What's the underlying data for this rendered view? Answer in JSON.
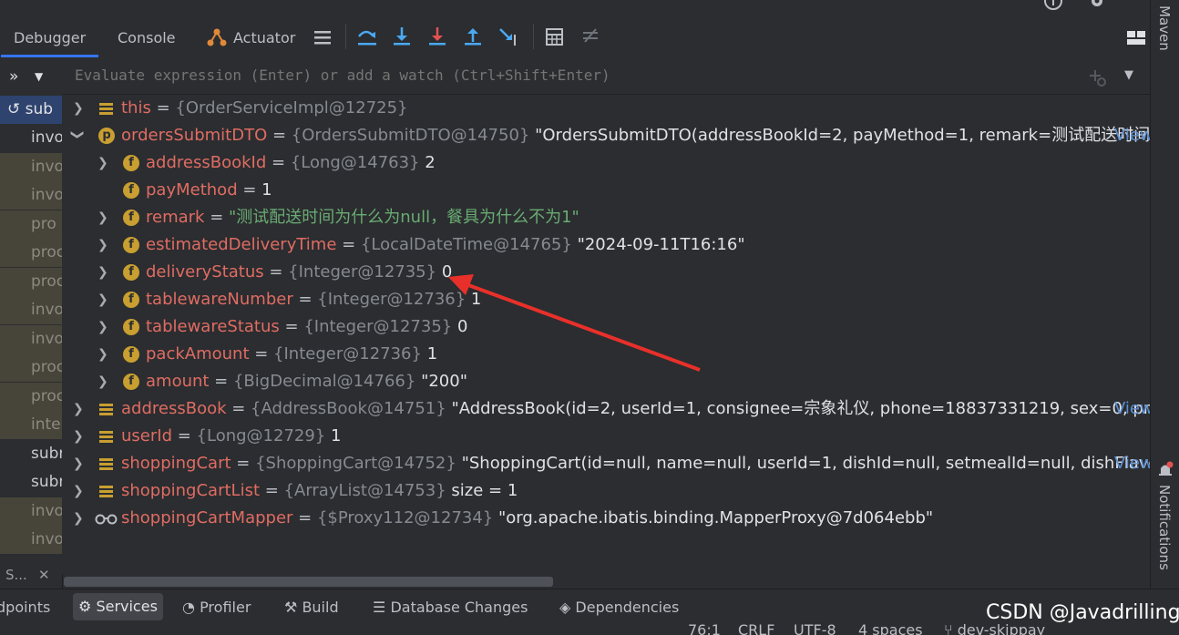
{
  "toolbar": {
    "tabs": [
      "Debugger",
      "Console",
      "Actuator"
    ]
  },
  "frames": {
    "items": [
      "sub",
      "invo",
      "invo",
      "invo",
      "pro",
      "proc",
      "proc",
      "invo",
      "invo",
      "proc",
      "proc",
      "inte",
      "subr",
      "subr",
      "invo",
      "invo"
    ],
    "footer_label": "S..."
  },
  "evaluate": {
    "placeholder": "Evaluate expression (Enter) or add a watch (Ctrl+Shift+Enter)"
  },
  "variables": [
    {
      "name": "this",
      "type": "{OrderServiceImpl@12725}",
      "value": ""
    },
    {
      "name": "ordersSubmitDTO",
      "type": "{OrdersSubmitDTO@14750}",
      "value": "\"OrdersSubmitDTO(addressBookId=2, payMethod=1, remark=测试配送时间...",
      "view": "View"
    },
    {
      "name": "addressBookId",
      "type": "{Long@14763}",
      "value": "2"
    },
    {
      "name": "payMethod",
      "type": "",
      "value": "1"
    },
    {
      "name": "remark",
      "type": "",
      "value": "\"测试配送时间为什么为null，餐具为什么不为1\""
    },
    {
      "name": "estimatedDeliveryTime",
      "type": "{LocalDateTime@14765}",
      "value": "\"2024-09-11T16:16\""
    },
    {
      "name": "deliveryStatus",
      "type": "{Integer@12735}",
      "value": "0"
    },
    {
      "name": "tablewareNumber",
      "type": "{Integer@12736}",
      "value": "1"
    },
    {
      "name": "tablewareStatus",
      "type": "{Integer@12735}",
      "value": "0"
    },
    {
      "name": "packAmount",
      "type": "{Integer@12736}",
      "value": "1"
    },
    {
      "name": "amount",
      "type": "{BigDecimal@14766}",
      "value": "\"200\""
    },
    {
      "name": "addressBook",
      "type": "{AddressBook@14751}",
      "value": "\"AddressBook(id=2, userId=1, consignee=宗象礼仪, phone=18837331219, sex=0, pro...",
      "view": "View"
    },
    {
      "name": "userId",
      "type": "{Long@12729}",
      "value": "1"
    },
    {
      "name": "shoppingCart",
      "type": "{ShoppingCart@14752}",
      "value": "\"ShoppingCart(id=null, name=null, userId=1, dishId=null, setmealId=null, dishFlavo...",
      "view": "View"
    },
    {
      "name": "shoppingCartList",
      "type": "{ArrayList@14753}",
      "value": " size = 1"
    },
    {
      "name": "shoppingCartMapper",
      "type": "{$Proxy112@12734}",
      "value": "\"org.apache.ibatis.binding.MapperProxy@7d064ebb\""
    }
  ],
  "right_strip": {
    "maven": "Maven",
    "notifications": "Notifications"
  },
  "bottom_tabs": [
    "dpoints",
    "Services",
    "Profiler",
    "Build",
    "Database Changes",
    "Dependencies"
  ],
  "status": {
    "position": "76:1",
    "line_sep": "CRLF",
    "encoding": "UTF-8",
    "indent": "4 spaces",
    "branch": "dev-skippay"
  },
  "watermark": "CSDN @Javadrilling",
  "colors": {
    "accent": "#3574f0",
    "field_name": "#e06c63",
    "string": "#6aab73",
    "link": "#5c8fd6",
    "annotation_arrow": "#e8302a"
  }
}
